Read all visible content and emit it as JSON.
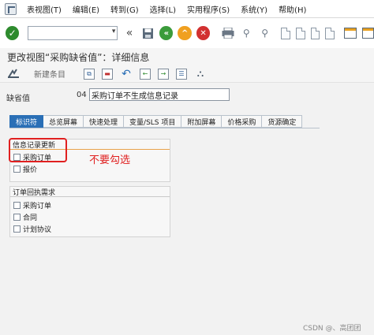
{
  "menu": {
    "items": [
      "表视图(T)",
      "编辑(E)",
      "转到(G)",
      "选择(L)",
      "实用程序(S)",
      "系统(Y)",
      "帮助(H)"
    ]
  },
  "toolbar": {
    "command_value": "",
    "icons": [
      "enter-icon",
      "back-double-icon",
      "save-icon",
      "back-icon",
      "exit-icon",
      "cancel-icon",
      "print-icon",
      "find-icon",
      "find-next-icon",
      "first-page-icon",
      "prev-page-icon",
      "next-page-icon",
      "last-page-icon",
      "create-session-icon",
      "shortcut-icon"
    ]
  },
  "title": "更改视图“采购缺省值”：详细信息",
  "app_toolbar": {
    "new_entries_label": "新建条目"
  },
  "field": {
    "label": "缺省值",
    "number": "04",
    "description": "采购订单不生成信息记录"
  },
  "tabs": [
    "标识符",
    "总览屏幕",
    "快速处理",
    "变量/SLS 项目",
    "附加屏幕",
    "价格采购",
    "货源确定"
  ],
  "active_tab": 0,
  "group_info_update": {
    "title": "信息记录更新",
    "items": [
      "采购订单",
      "报价"
    ]
  },
  "group_order_ack": {
    "title": "订单回执需求",
    "items": [
      "采购订单",
      "合同",
      "计划协议"
    ]
  },
  "annotation": {
    "note": "不要勾选"
  },
  "watermark": "CSDN @、高团团",
  "colors": {
    "active_tab": "#2a6fb6",
    "annotation": "#e02020",
    "group_line_orange": "#e8a24a"
  }
}
